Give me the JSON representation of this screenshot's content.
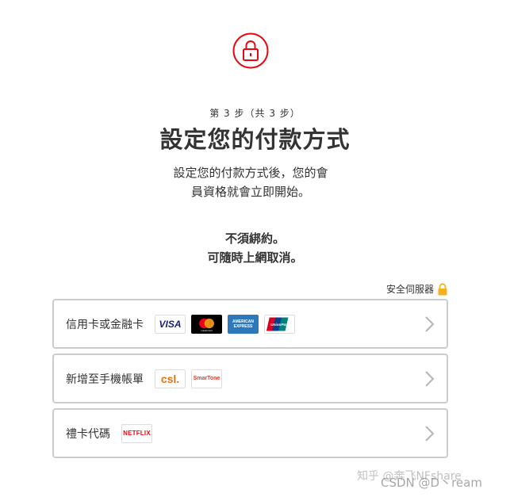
{
  "header": {
    "lock_icon": "lock-icon",
    "accent_color": "#e50914",
    "step": "第 3 步（共 3 步）",
    "title": "設定您的付款方式",
    "description": "設定您的付款方式後，您的會員資格就會立即開始。",
    "no_commitment_line1": "不須綁約。",
    "no_commitment_line2": "可隨時上網取消。"
  },
  "secure": {
    "label": "安全伺服器",
    "icon": "lock-icon",
    "color": "#f5b01f"
  },
  "options": [
    {
      "label": "信用卡或金融卡",
      "logos": [
        "VISA",
        "Mastercard",
        "American Express",
        "UnionPay"
      ]
    },
    {
      "label": "新增至手機帳單",
      "logos": [
        "csl.",
        "SmarTone"
      ]
    },
    {
      "label": "禮卡代碼",
      "logos": [
        "NETFLIX"
      ]
    }
  ],
  "logo_text": {
    "visa": "VISA",
    "mc": "mastercard",
    "amex_1": "AMERICAN",
    "amex_2": "EXPRESS",
    "unionpay": "UnionPay",
    "csl": "csl.",
    "smartone": "SmarTone",
    "netflix": "NETFLIX"
  },
  "watermark": {
    "line1": "知乎 @奔飞NFshare",
    "line2": "CSDN @D丶ream"
  }
}
